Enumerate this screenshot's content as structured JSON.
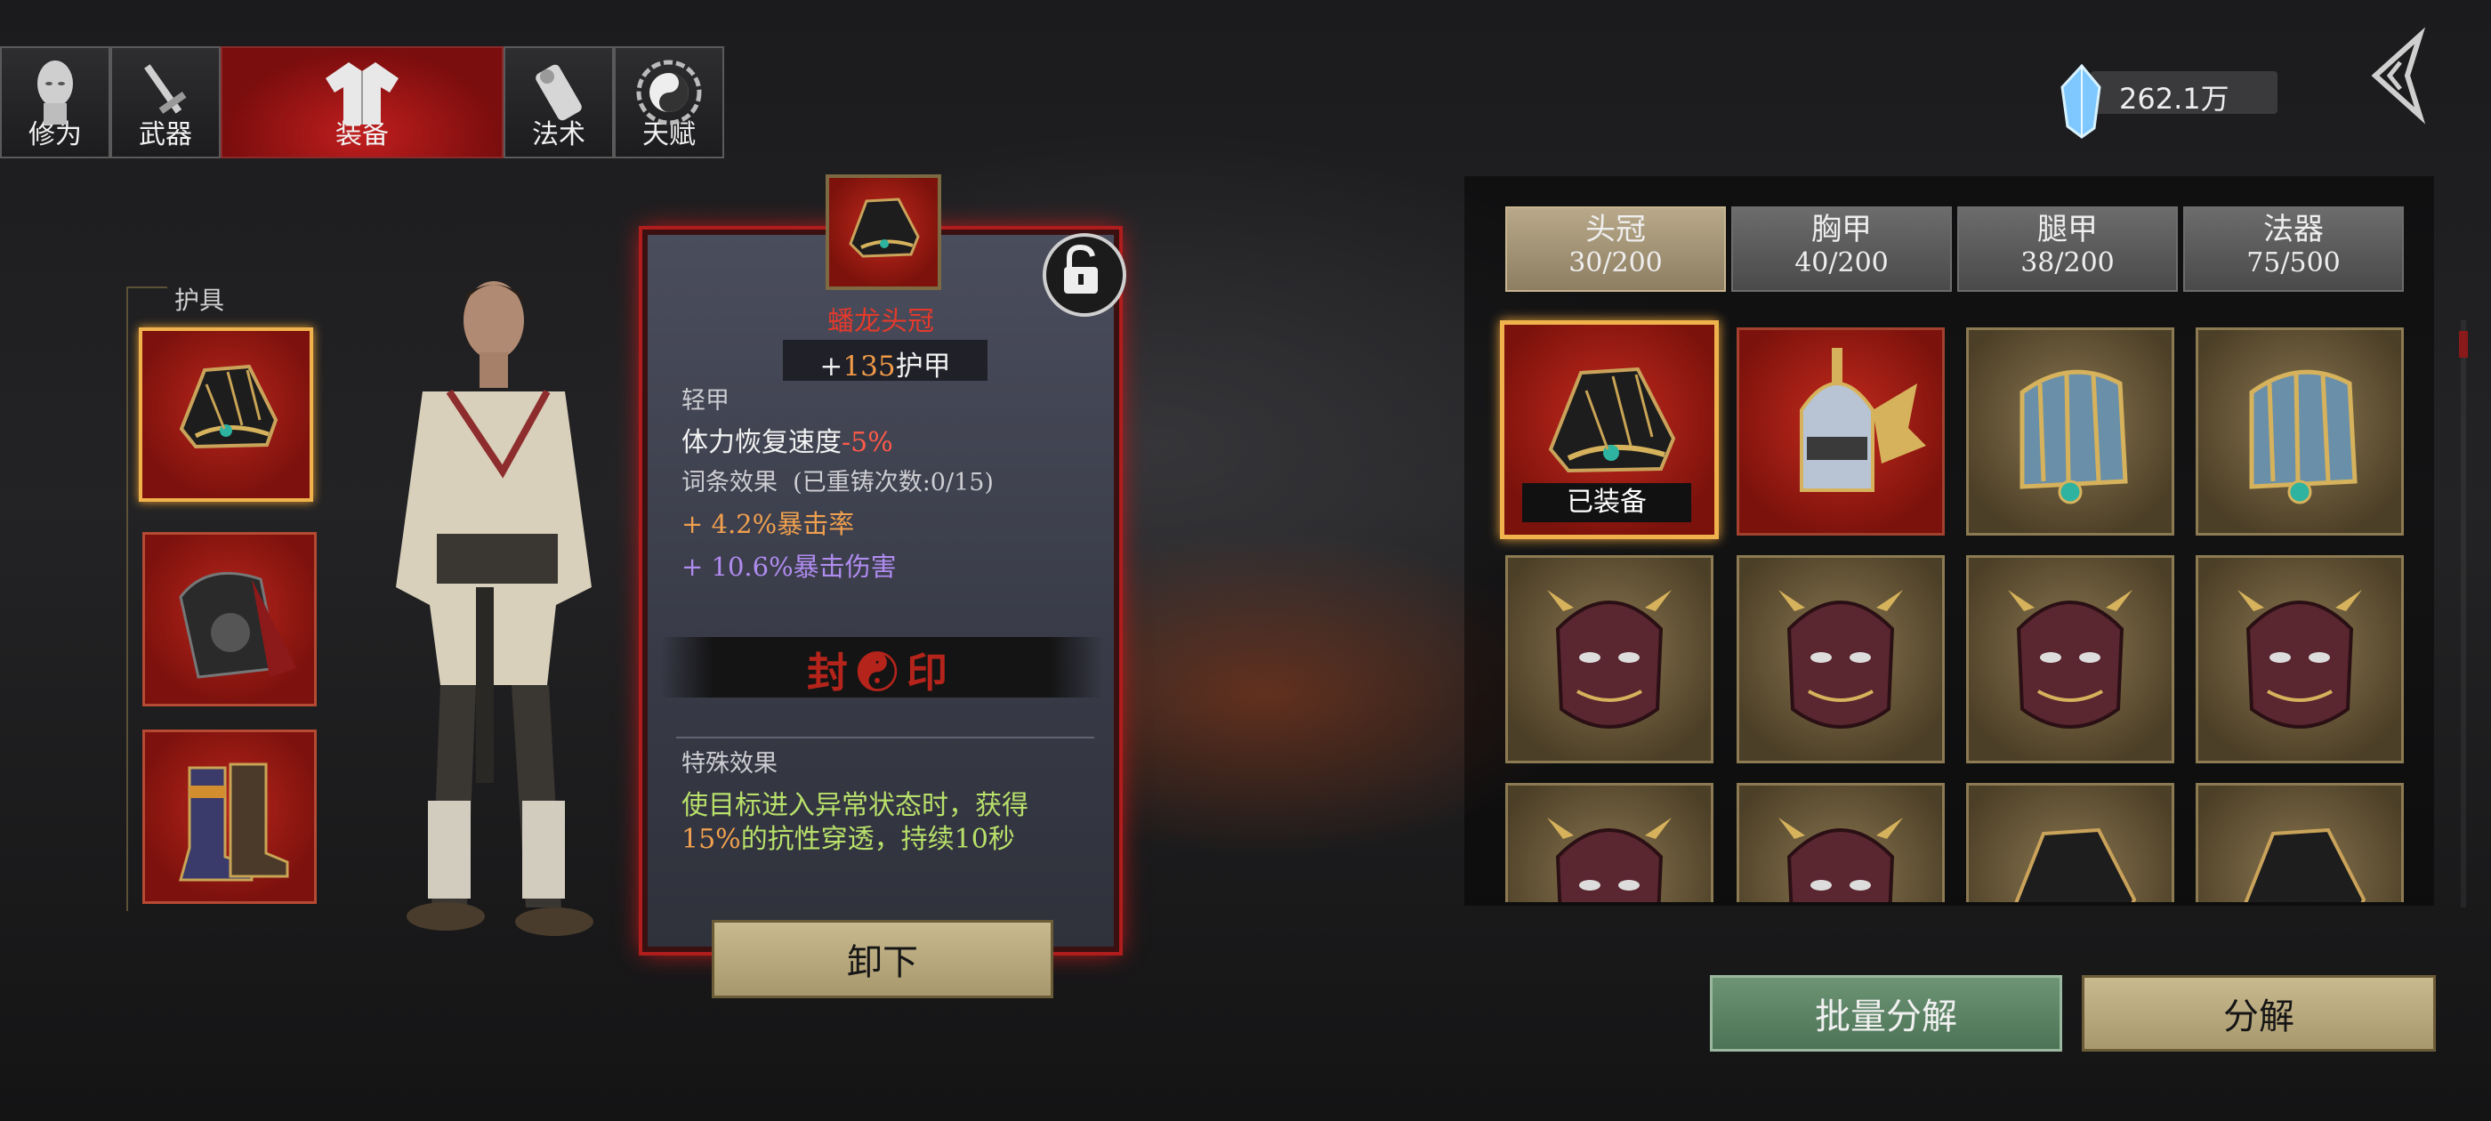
{
  "tabs": [
    {
      "label": "修为",
      "icon": "head-icon"
    },
    {
      "label": "武器",
      "icon": "sword-icon"
    },
    {
      "label": "装备",
      "icon": "robe-icon",
      "active": true
    },
    {
      "label": "法术",
      "icon": "scroll-icon"
    },
    {
      "label": "天赋",
      "icon": "yin-yang-icon"
    }
  ],
  "currency": {
    "value": "262.1万",
    "icon": "crystal-icon"
  },
  "armor_slots": {
    "title": "护具",
    "items": [
      {
        "icon": "dragon-crown-icon",
        "selected": true
      },
      {
        "icon": "shoulder-armor-icon"
      },
      {
        "icon": "boots-icon"
      }
    ]
  },
  "detail": {
    "name": "蟠龙头冠",
    "armor_prefix": "+",
    "armor_value": "135",
    "armor_suffix": "护甲",
    "weight_class": "轻甲",
    "stat_label": "体力恢复速度",
    "stat_value": "-5%",
    "affix_header": "词条效果",
    "reforge": "(已重铸次数:0/15)",
    "affix1": "+ 4.2%暴击率",
    "affix2": "+ 10.6%暴击伤害",
    "seal_label": "封☯印",
    "special_header": "特殊效果",
    "special_line1": "使目标进入异常状态时，获得",
    "special_value": "15%",
    "special_line2": "的抗性穿透，持续10秒",
    "unequip_label": "卸下",
    "lock_icon": "unlock-icon"
  },
  "categories": [
    {
      "name": "头冠",
      "count": "30/200",
      "active": true
    },
    {
      "name": "胸甲",
      "count": "40/200"
    },
    {
      "name": "腿甲",
      "count": "38/200"
    },
    {
      "name": "法器",
      "count": "75/500"
    }
  ],
  "inventory": [
    {
      "icon": "dragon-crown-icon",
      "bg": "red",
      "equipped_label": "已装备",
      "selected": true
    },
    {
      "icon": "winged-helmet-icon",
      "bg": "red"
    },
    {
      "icon": "blue-crown-icon",
      "bg": "gold"
    },
    {
      "icon": "blue-crown-icon",
      "bg": "gold"
    },
    {
      "icon": "demon-mask-icon",
      "bg": "gold"
    },
    {
      "icon": "demon-mask-icon",
      "bg": "gold"
    },
    {
      "icon": "demon-mask-icon",
      "bg": "gold"
    },
    {
      "icon": "demon-mask-icon",
      "bg": "gold"
    },
    {
      "icon": "demon-mask-icon",
      "bg": "gold"
    },
    {
      "icon": "demon-mask-icon",
      "bg": "gold"
    },
    {
      "icon": "dragon-crown-icon",
      "bg": "gold"
    },
    {
      "icon": "dragon-crown-icon",
      "bg": "gold"
    }
  ],
  "actions": {
    "batch_decompose": "批量分解",
    "decompose": "分解"
  },
  "colors": {
    "accent_red": "#c01e1e",
    "gold_border": "#f0b24c",
    "panel_glow": "#d21a1a"
  }
}
